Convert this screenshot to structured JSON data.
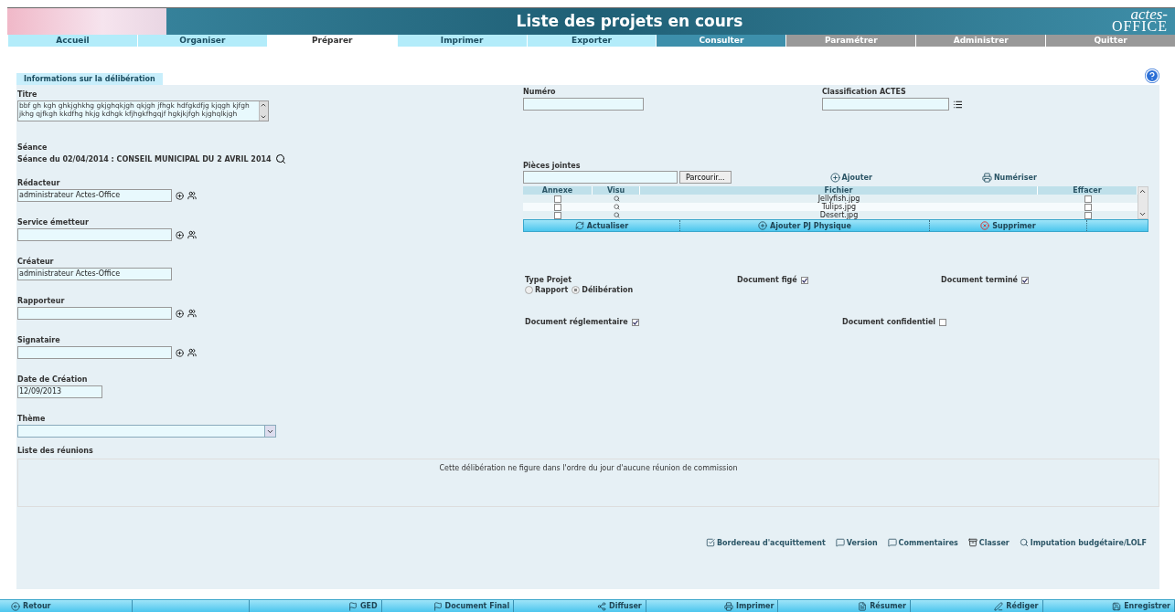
{
  "header": {
    "title": "Liste des projets en cours",
    "logo": {
      "line1": "actes-",
      "line2": "OFFICE"
    }
  },
  "nav": [
    {
      "label": "Accueil",
      "kind": "module",
      "selected": false
    },
    {
      "label": "Organiser",
      "kind": "module",
      "selected": false
    },
    {
      "label": "Préparer",
      "kind": "module",
      "selected": true
    },
    {
      "label": "Imprimer",
      "kind": "module",
      "selected": false
    },
    {
      "label": "Exporter",
      "kind": "module",
      "selected": false
    },
    {
      "label": "Consulter",
      "kind": "consult",
      "selected": false
    },
    {
      "label": "Paramétrer",
      "kind": "admin",
      "selected": false
    },
    {
      "label": "Administrer",
      "kind": "admin",
      "selected": false
    },
    {
      "label": "Quitter",
      "kind": "admin",
      "selected": false
    }
  ],
  "section_tab": "Informations sur la délibération",
  "titre": {
    "label": "Titre",
    "value": "bbf gh kgh ghkjghkhg gkjghqkjgh qkjgh jfhgk hdfgkdfjg kjqgh kjfgh jkhg qjfkgh  kkdfhg hkjg kdhgk kfjhgkfhgqjf hgkjkjfgh kjghqlkjgh"
  },
  "numero": {
    "label": "Numéro"
  },
  "classification": {
    "label": "Classification ACTES"
  },
  "seance": {
    "label": "Séance",
    "value": "Séance du 02/04/2014 : CONSEIL MUNICIPAL DU 2 AVRIL 2014"
  },
  "fields": [
    {
      "label": "Rédacteur",
      "value": "administrateur Actes-Office",
      "kind": "picker"
    },
    {
      "label": "Service émetteur",
      "kind": "picker"
    },
    {
      "label": "Créateur",
      "value": "administrateur Actes-Office",
      "kind": "plain"
    },
    {
      "label": "Rapporteur",
      "kind": "picker"
    },
    {
      "label": "Signataire",
      "kind": "picker"
    },
    {
      "label": "Date de Création",
      "value": "12/09/2013",
      "kind": "date"
    },
    {
      "label": "Thème",
      "kind": "select"
    }
  ],
  "attachments": {
    "label": "Pièces jointes",
    "browse": "Parcourir...",
    "add": "Ajouter",
    "scan": "Numériser",
    "columns": [
      "Annexe",
      "Visu",
      "Fichier",
      "Effacer"
    ],
    "rows": [
      {
        "annexe": false,
        "file": "Jellyfish.jpg",
        "delete": false
      },
      {
        "annexe": false,
        "file": "Tulips.jpg",
        "delete": false
      },
      {
        "annexe": false,
        "file": "Desert.jpg",
        "delete": false
      }
    ],
    "actions": [
      {
        "label": "Actualiser",
        "kind": "refresh"
      },
      {
        "label": "Ajouter PJ Physique",
        "kind": "add"
      },
      {
        "label": "Supprimer",
        "kind": "delete"
      }
    ]
  },
  "type_projet": {
    "label": "Type Projet",
    "options": [
      {
        "label": "Rapport",
        "selected": false
      },
      {
        "label": "Délibération",
        "selected": true
      }
    ]
  },
  "flags": [
    {
      "label": "Document figé",
      "checked": true
    },
    {
      "label": "Document terminé",
      "checked": true
    },
    {
      "label": "Document réglementaire",
      "checked": true
    },
    {
      "label": "Document confidentiel",
      "checked": false
    }
  ],
  "reunions": {
    "label": "Liste des réunions",
    "message": "Cette délibération ne figure dans l'ordre du jour d'aucune réunion de commission"
  },
  "links": [
    {
      "label": "Bordereau d'acquittement",
      "kind": "check"
    },
    {
      "label": "Version",
      "kind": "comment"
    },
    {
      "label": "Commentaires",
      "kind": "comment"
    },
    {
      "label": "Classer",
      "kind": "archive"
    },
    {
      "label": "Imputation budgétaire/LOLF",
      "kind": "search"
    }
  ],
  "footer": [
    {
      "label": "Retour",
      "kind": "back"
    },
    {
      "kind": "empty"
    },
    {
      "label": "GED",
      "kind": "flag"
    },
    {
      "label": "Document Final",
      "kind": "flag"
    },
    {
      "label": "Diffuser",
      "kind": "share"
    },
    {
      "label": "Imprimer",
      "kind": "print"
    },
    {
      "label": "Résumer",
      "kind": "summary"
    },
    {
      "label": "Rédiger",
      "kind": "edit"
    },
    {
      "label": "Enregistrer",
      "kind": "save"
    }
  ]
}
